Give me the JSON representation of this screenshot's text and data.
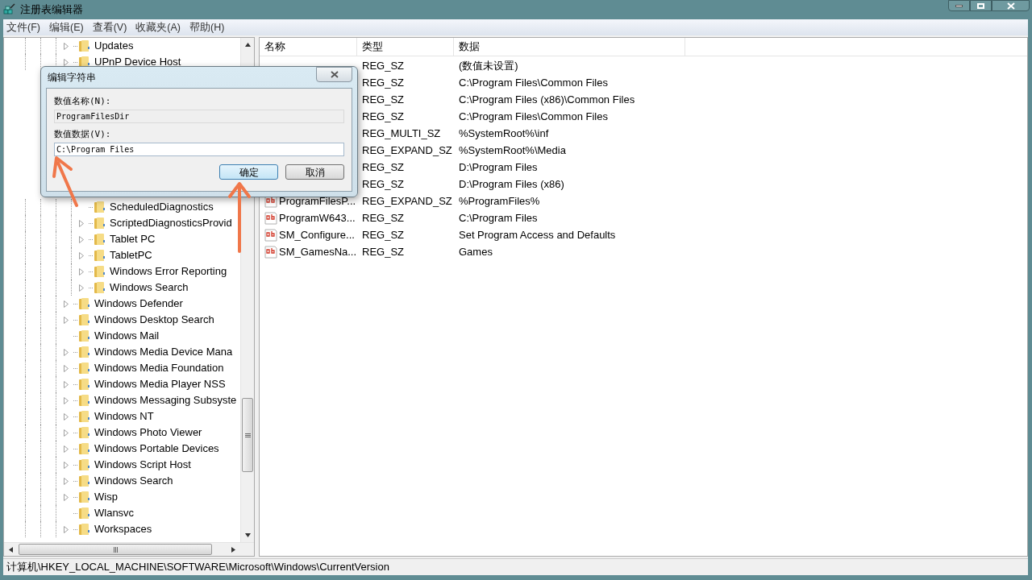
{
  "window": {
    "title": "注册表编辑器"
  },
  "menu": [
    "文件(F)",
    "编辑(E)",
    "查看(V)",
    "收藏夹(A)",
    "帮助(H)"
  ],
  "tree": {
    "items": [
      {
        "label": "Updates",
        "expandable": true
      },
      {
        "label": "UPnP Device Host",
        "expandable": true
      },
      {
        "children": [
          {
            "label": "ScheduledDiagnostics",
            "expandable": false
          },
          {
            "label": "ScriptedDiagnosticsProvid",
            "expandable": true
          },
          {
            "label": "Tablet PC",
            "expandable": true
          },
          {
            "label": "TabletPC",
            "expandable": true
          },
          {
            "label": "Windows Error Reporting",
            "expandable": true
          },
          {
            "label": "Windows Search",
            "expandable": true
          }
        ]
      },
      {
        "label": "Windows Defender",
        "expandable": true
      },
      {
        "label": "Windows Desktop Search",
        "expandable": true
      },
      {
        "label": "Windows Mail",
        "expandable": false
      },
      {
        "label": "Windows Media Device Mana",
        "expandable": true
      },
      {
        "label": "Windows Media Foundation",
        "expandable": true
      },
      {
        "label": "Windows Media Player NSS",
        "expandable": true
      },
      {
        "label": "Windows Messaging Subsyste",
        "expandable": true
      },
      {
        "label": "Windows NT",
        "expandable": true
      },
      {
        "label": "Windows Photo Viewer",
        "expandable": true
      },
      {
        "label": "Windows Portable Devices",
        "expandable": true
      },
      {
        "label": "Windows Script Host",
        "expandable": true
      },
      {
        "label": "Windows Search",
        "expandable": true
      },
      {
        "label": "Wisp",
        "expandable": true
      },
      {
        "label": "Wlansvc",
        "expandable": false
      },
      {
        "label": "Workspaces",
        "expandable": true
      }
    ]
  },
  "list": {
    "columns": [
      "名称",
      "类型",
      "数据"
    ],
    "rows": [
      {
        "type": "REG_SZ",
        "data": "(数值未设置)"
      },
      {
        "type": "REG_SZ",
        "data": "C:\\Program Files\\Common Files"
      },
      {
        "type": "REG_SZ",
        "data": "C:\\Program Files (x86)\\Common Files"
      },
      {
        "type": "REG_SZ",
        "data": "C:\\Program Files\\Common Files"
      },
      {
        "type": "REG_MULTI_SZ",
        "data": "%SystemRoot%\\inf"
      },
      {
        "type": "REG_EXPAND_SZ",
        "data": "%SystemRoot%\\Media"
      },
      {
        "type": "REG_SZ",
        "data": "D:\\Program Files"
      },
      {
        "type": "REG_SZ",
        "data": "D:\\Program Files (x86)"
      },
      {
        "name": "ProgramFilesP...",
        "type": "REG_EXPAND_SZ",
        "data": "%ProgramFiles%"
      },
      {
        "name": "ProgramW643...",
        "type": "REG_SZ",
        "data": "C:\\Program Files"
      },
      {
        "name": "SM_Configure...",
        "type": "REG_SZ",
        "data": "Set Program Access and Defaults"
      },
      {
        "name": "SM_GamesNa...",
        "type": "REG_SZ",
        "data": "Games"
      }
    ]
  },
  "dialog": {
    "title": "编辑字符串",
    "name_label": "数值名称(N):",
    "name_value": "ProgramFilesDir",
    "data_label": "数值数据(V):",
    "data_value": "C:\\Program Files",
    "buttons": [
      {
        "label": "确定",
        "default": true
      },
      {
        "label": "取消",
        "default": false
      }
    ]
  },
  "status_bar": "计算机\\HKEY_LOCAL_MACHINE\\SOFTWARE\\Microsoft\\Windows\\CurrentVersion"
}
